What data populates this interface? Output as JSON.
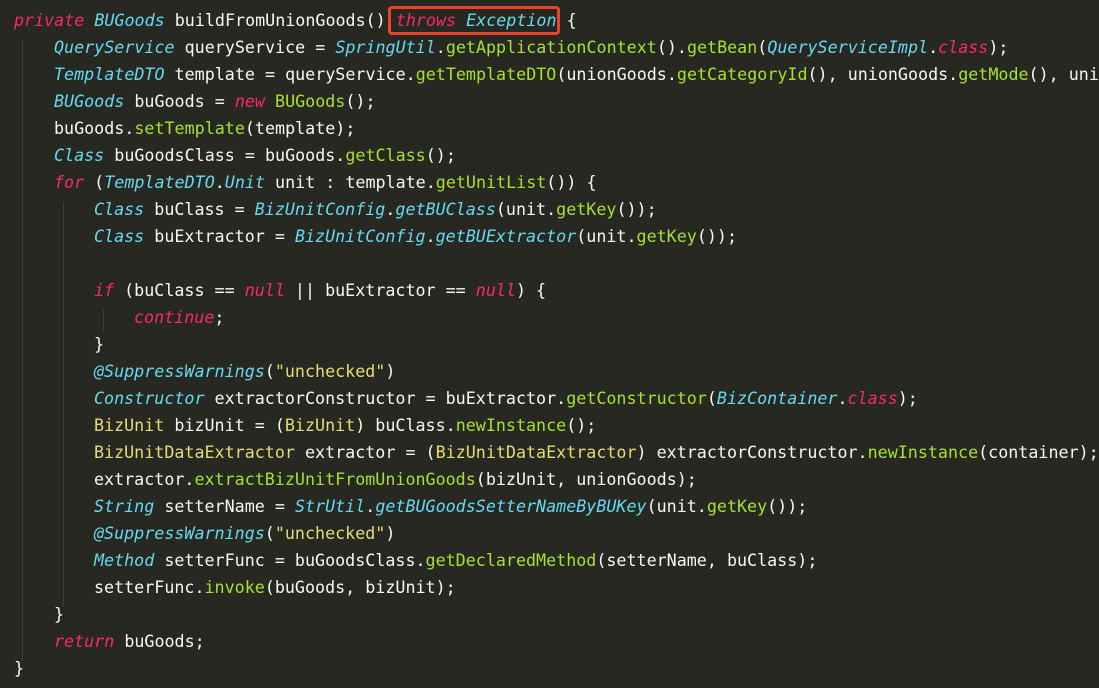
{
  "editor": {
    "lines": [
      {
        "indent": 0,
        "tokens": [
          {
            "t": "private",
            "c": "kw"
          },
          {
            "t": " "
          },
          {
            "t": "BUGoods",
            "c": "typ"
          },
          {
            "t": " "
          },
          {
            "t": "buildFromUnionGoods",
            "c": "pl"
          },
          {
            "t": "() "
          },
          {
            "t": "throws",
            "c": "kw"
          },
          {
            "t": " "
          },
          {
            "t": "Exception",
            "c": "typ"
          },
          {
            "t": " {"
          }
        ]
      },
      {
        "indent": 1,
        "tokens": [
          {
            "t": "QueryService",
            "c": "typ"
          },
          {
            "t": " queryService = "
          },
          {
            "t": "SpringUtil",
            "c": "typ"
          },
          {
            "t": "."
          },
          {
            "t": "getApplicationContext",
            "c": "fn"
          },
          {
            "t": "()."
          },
          {
            "t": "getBean",
            "c": "fn"
          },
          {
            "t": "("
          },
          {
            "t": "QueryServiceImpl",
            "c": "typ"
          },
          {
            "t": "."
          },
          {
            "t": "class",
            "c": "kw"
          },
          {
            "t": ");"
          }
        ]
      },
      {
        "indent": 1,
        "tokens": [
          {
            "t": "TemplateDTO",
            "c": "typ"
          },
          {
            "t": " template = queryService."
          },
          {
            "t": "getTemplateDTO",
            "c": "fn"
          },
          {
            "t": "(unionGoods."
          },
          {
            "t": "getCategoryId",
            "c": "fn"
          },
          {
            "t": "(), unionGoods."
          },
          {
            "t": "getMode",
            "c": "fn"
          },
          {
            "t": "(), unio"
          }
        ]
      },
      {
        "indent": 1,
        "tokens": [
          {
            "t": "BUGoods",
            "c": "typ"
          },
          {
            "t": " buGoods = "
          },
          {
            "t": "new",
            "c": "kw"
          },
          {
            "t": " "
          },
          {
            "t": "BUGoods",
            "c": "fn"
          },
          {
            "t": "();"
          }
        ]
      },
      {
        "indent": 1,
        "tokens": [
          {
            "t": "buGoods."
          },
          {
            "t": "setTemplate",
            "c": "fn"
          },
          {
            "t": "(template);"
          }
        ]
      },
      {
        "indent": 1,
        "tokens": [
          {
            "t": "Class",
            "c": "typ"
          },
          {
            "t": " buGoodsClass = buGoods."
          },
          {
            "t": "getClass",
            "c": "fn"
          },
          {
            "t": "();"
          }
        ]
      },
      {
        "indent": 1,
        "tokens": [
          {
            "t": "for",
            "c": "kw"
          },
          {
            "t": " ("
          },
          {
            "t": "TemplateDTO",
            "c": "typ"
          },
          {
            "t": "."
          },
          {
            "t": "Unit",
            "c": "typ"
          },
          {
            "t": " unit : template."
          },
          {
            "t": "getUnitList",
            "c": "fn"
          },
          {
            "t": "()) {"
          }
        ]
      },
      {
        "indent": 2,
        "tokens": [
          {
            "t": "Class",
            "c": "typ"
          },
          {
            "t": " buClass = "
          },
          {
            "t": "BizUnitConfig",
            "c": "typ"
          },
          {
            "t": "."
          },
          {
            "t": "getBUClass",
            "c": "typ"
          },
          {
            "t": "(unit."
          },
          {
            "t": "getKey",
            "c": "fn"
          },
          {
            "t": "());"
          }
        ]
      },
      {
        "indent": 2,
        "tokens": [
          {
            "t": "Class",
            "c": "typ"
          },
          {
            "t": " buExtractor = "
          },
          {
            "t": "BizUnitConfig",
            "c": "typ"
          },
          {
            "t": "."
          },
          {
            "t": "getBUExtractor",
            "c": "typ"
          },
          {
            "t": "(unit."
          },
          {
            "t": "getKey",
            "c": "fn"
          },
          {
            "t": "());"
          }
        ]
      },
      {
        "indent": 0,
        "tokens": []
      },
      {
        "indent": 2,
        "tokens": [
          {
            "t": "if",
            "c": "kw"
          },
          {
            "t": " (buClass == "
          },
          {
            "t": "null",
            "c": "kw"
          },
          {
            "t": " || buExtractor == "
          },
          {
            "t": "null",
            "c": "kw"
          },
          {
            "t": ") {"
          }
        ]
      },
      {
        "indent": 3,
        "tokens": [
          {
            "t": "continue",
            "c": "kw"
          },
          {
            "t": ";"
          }
        ]
      },
      {
        "indent": 2,
        "tokens": [
          {
            "t": "}"
          }
        ]
      },
      {
        "indent": 2,
        "tokens": [
          {
            "t": "@SuppressWarnings",
            "c": "ann"
          },
          {
            "t": "("
          },
          {
            "t": "\"unchecked\"",
            "c": "str"
          },
          {
            "t": ")"
          }
        ]
      },
      {
        "indent": 2,
        "tokens": [
          {
            "t": "Constructor",
            "c": "typ"
          },
          {
            "t": " extractorConstructor = buExtractor."
          },
          {
            "t": "getConstructor",
            "c": "fn"
          },
          {
            "t": "("
          },
          {
            "t": "BizContainer",
            "c": "typ"
          },
          {
            "t": "."
          },
          {
            "t": "class",
            "c": "kw"
          },
          {
            "t": ");"
          }
        ]
      },
      {
        "indent": 2,
        "tokens": [
          {
            "t": "BizUnit",
            "c": "str"
          },
          {
            "t": " bizUnit = ("
          },
          {
            "t": "BizUnit",
            "c": "str"
          },
          {
            "t": ") buClass."
          },
          {
            "t": "newInstance",
            "c": "fn"
          },
          {
            "t": "();"
          }
        ]
      },
      {
        "indent": 2,
        "tokens": [
          {
            "t": "BizUnitDataExtractor",
            "c": "str"
          },
          {
            "t": " extractor = ("
          },
          {
            "t": "BizUnitDataExtractor",
            "c": "str"
          },
          {
            "t": ") extractorConstructor."
          },
          {
            "t": "newInstance",
            "c": "fn"
          },
          {
            "t": "(container);"
          }
        ]
      },
      {
        "indent": 2,
        "tokens": [
          {
            "t": "extractor."
          },
          {
            "t": "extractBizUnitFromUnionGoods",
            "c": "fn"
          },
          {
            "t": "(bizUnit, unionGoods);"
          }
        ]
      },
      {
        "indent": 2,
        "tokens": [
          {
            "t": "String",
            "c": "typ"
          },
          {
            "t": " setterName = "
          },
          {
            "t": "StrUtil",
            "c": "typ"
          },
          {
            "t": "."
          },
          {
            "t": "getBUGoodsSetterNameByBUKey",
            "c": "typ"
          },
          {
            "t": "(unit."
          },
          {
            "t": "getKey",
            "c": "fn"
          },
          {
            "t": "());"
          }
        ]
      },
      {
        "indent": 2,
        "tokens": [
          {
            "t": "@SuppressWarnings",
            "c": "ann"
          },
          {
            "t": "("
          },
          {
            "t": "\"unchecked\"",
            "c": "str"
          },
          {
            "t": ")"
          }
        ]
      },
      {
        "indent": 2,
        "tokens": [
          {
            "t": "Method",
            "c": "typ"
          },
          {
            "t": " setterFunc = buGoodsClass."
          },
          {
            "t": "getDeclaredMethod",
            "c": "fn"
          },
          {
            "t": "(setterName, buClass);"
          }
        ]
      },
      {
        "indent": 2,
        "tokens": [
          {
            "t": "setterFunc."
          },
          {
            "t": "invoke",
            "c": "fn"
          },
          {
            "t": "(buGoods, bizUnit);"
          }
        ]
      },
      {
        "indent": 1,
        "tokens": [
          {
            "t": "}"
          }
        ]
      },
      {
        "indent": 1,
        "tokens": [
          {
            "t": "return",
            "c": "kw"
          },
          {
            "t": " buGoods;"
          }
        ]
      },
      {
        "indent": 0,
        "tokens": [
          {
            "t": "}"
          }
        ]
      }
    ]
  },
  "highlight": {
    "text": "throws Exception",
    "color": "#E8442C"
  },
  "theme": {
    "background": "#272822",
    "keyword": "#F92672",
    "type": "#66D9EF",
    "function": "#A6E22E",
    "string": "#E6DB74",
    "plain": "#F8F8F2"
  }
}
